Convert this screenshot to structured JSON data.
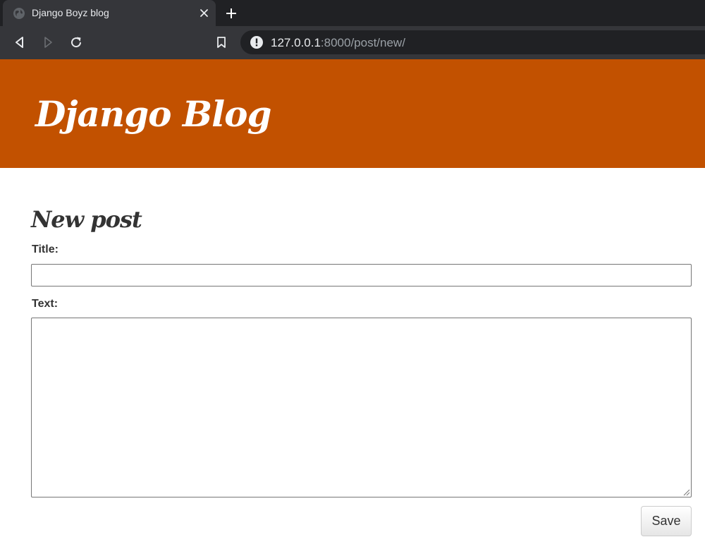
{
  "browser": {
    "tab": {
      "title": "Django Boyz blog",
      "favicon": "globe-icon",
      "close_icon": "close-icon"
    },
    "new_tab_icon": "plus-icon",
    "nav": {
      "back_icon": "back-arrow-icon",
      "forward_icon": "forward-arrow-icon",
      "reload_icon": "reload-icon",
      "bookmark_icon": "bookmark-icon"
    },
    "address_bar": {
      "site_info_icon": "info-icon",
      "host": "127.0.0.1",
      "path": ":8000/post/new/"
    }
  },
  "header": {
    "site_title": "Django Blog",
    "background_color": "#c25100"
  },
  "form": {
    "heading": "New post",
    "title_label": "Title:",
    "title_value": "",
    "text_label": "Text:",
    "text_value": "",
    "save_label": "Save"
  }
}
